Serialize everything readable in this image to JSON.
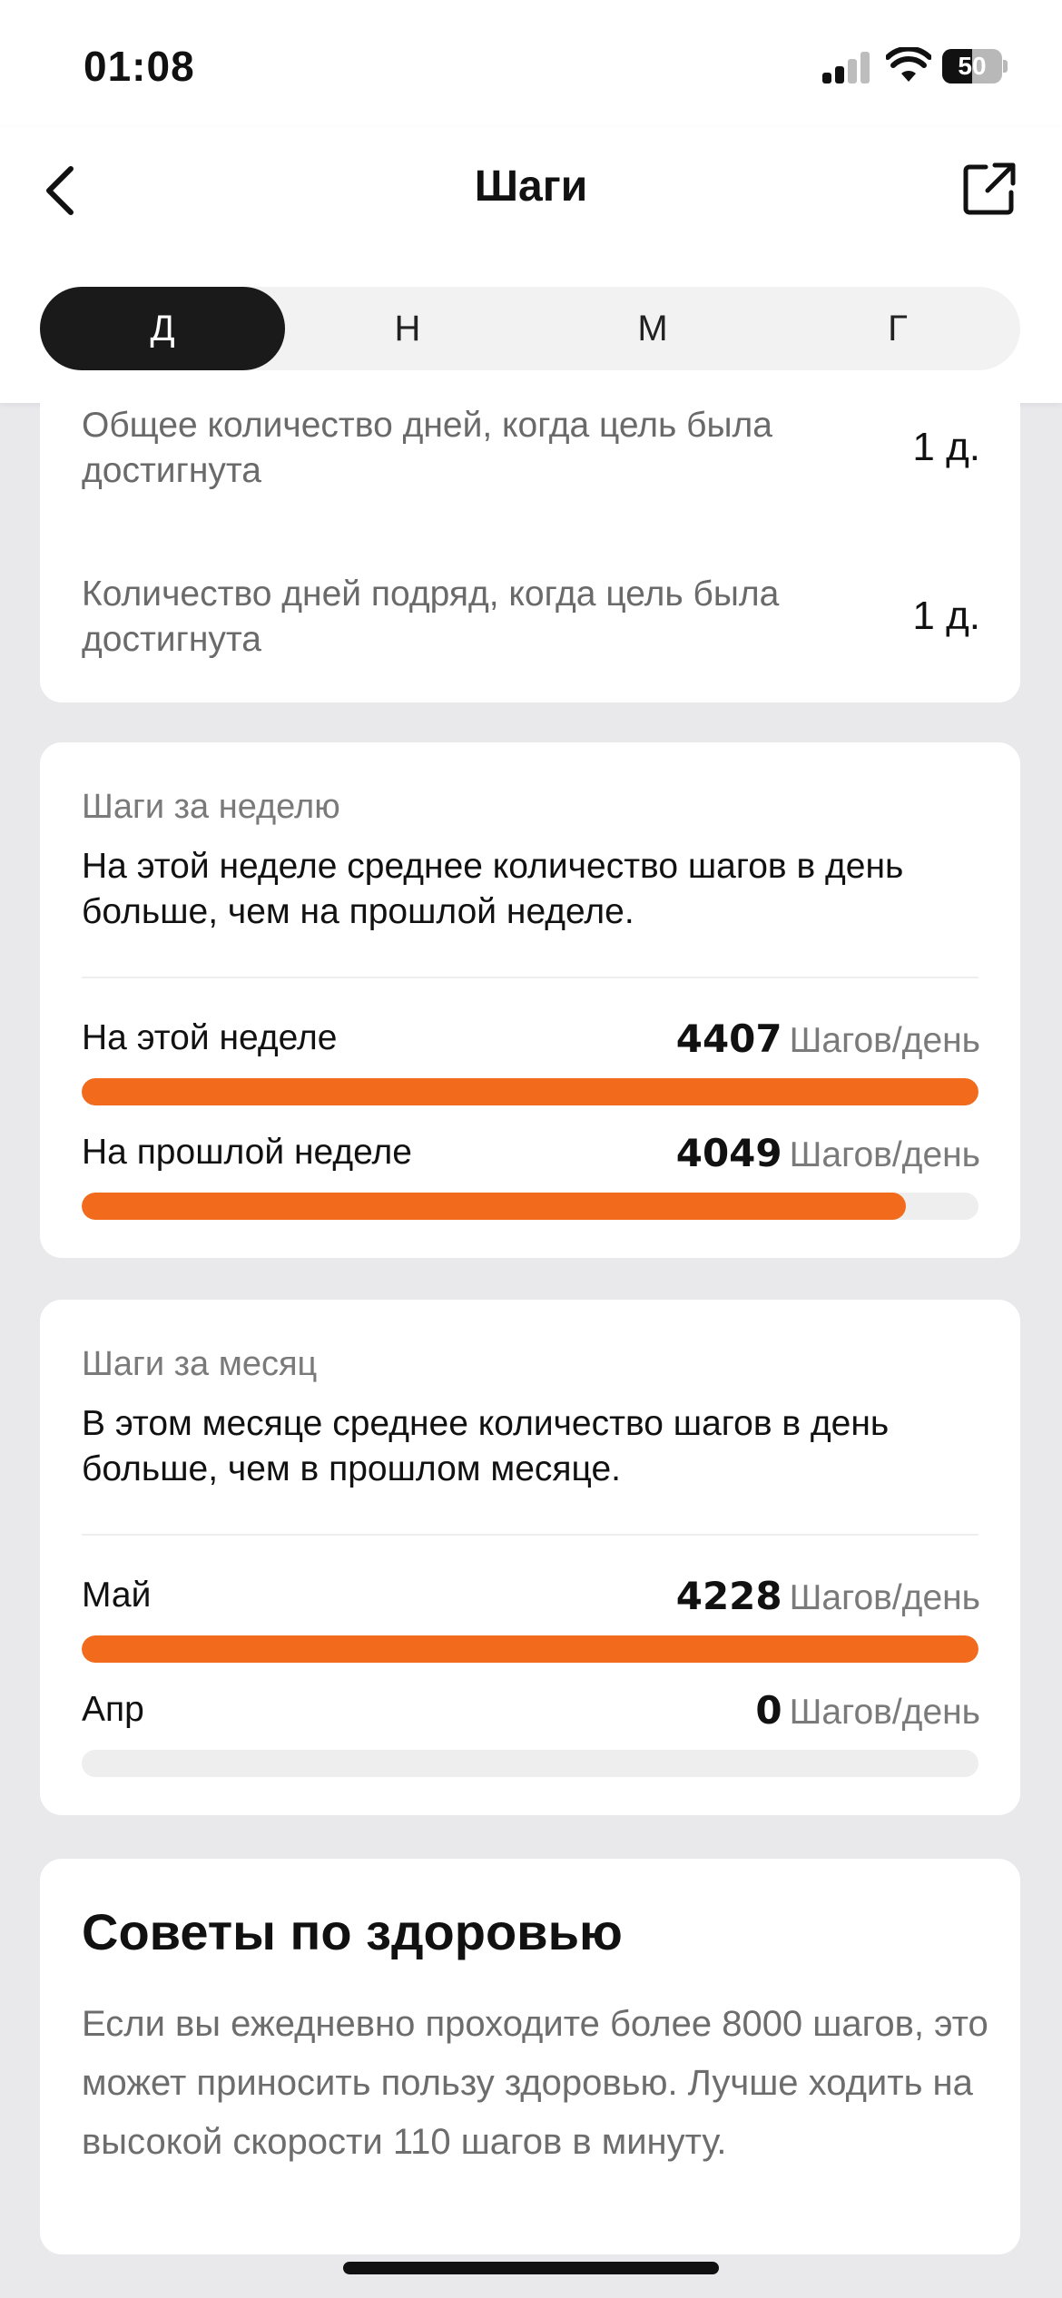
{
  "status_bar": {
    "time": "01:08",
    "battery": "50"
  },
  "header": {
    "title": "Шаги"
  },
  "tabs": [
    "Д",
    "Н",
    "М",
    "Г"
  ],
  "goal_stats": [
    {
      "label": "Общее количество дней, когда цель была достигнута",
      "value": "1 д."
    },
    {
      "label": "Количество дней подряд, когда цель была достигнута",
      "value": "1 д."
    }
  ],
  "weekly": {
    "caption": "Шаги за неделю",
    "description": "На этой неделе среднее количество шагов в день больше, чем на прошлой неделе.",
    "unit": "Шагов/день",
    "rows": [
      {
        "label": "На этой неделе",
        "value": "4407",
        "fraction": 1.0
      },
      {
        "label": "На прошлой неделе",
        "value": "4049",
        "fraction": 0.919
      }
    ]
  },
  "monthly": {
    "caption": "Шаги за месяц",
    "description": "В этом месяце среднее количество шагов в день больше, чем в прошлом месяце.",
    "unit": "Шагов/день",
    "rows": [
      {
        "label": "Май",
        "value": "4228",
        "fraction": 1.0
      },
      {
        "label": "Апр",
        "value": "0",
        "fraction": 0.0
      }
    ]
  },
  "tips": {
    "title": "Советы по здоровью",
    "text": "Если вы ежедневно проходите более 8000 шагов, это может приносить пользу здоровью. Лучше ходить на высокой скорости 110 шагов в минуту."
  },
  "colors": {
    "accent": "#f26a1b",
    "active_tab": "#1a1a1a",
    "track": "#eeeeee"
  },
  "icons": [
    "back-chevron-icon",
    "share-export-icon",
    "cellular-signal-icon",
    "wifi-icon",
    "battery-icon"
  ]
}
